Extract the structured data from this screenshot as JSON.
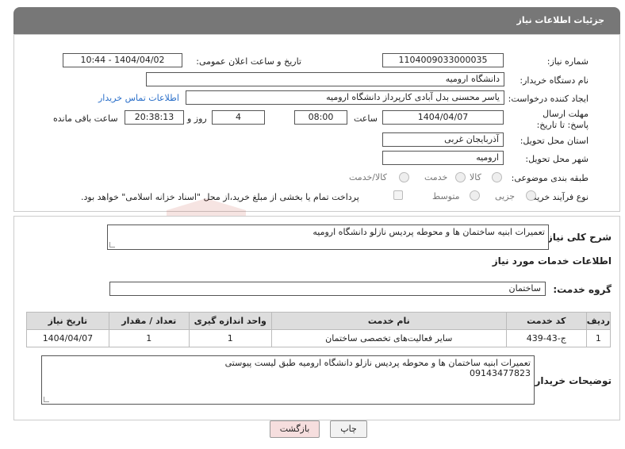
{
  "page_title": "جزئیات اطلاعات نیاز",
  "fields": {
    "need_number_label": "شماره نیاز:",
    "need_number": "1104009033000035",
    "announce_label": "تاریخ و ساعت اعلان عمومی:",
    "announce_value": "1404/04/02 - 10:44",
    "buyer_org_label": "نام دستگاه خریدار:",
    "buyer_org": "دانشگاه ارومیه",
    "creator_label": "ایجاد کننده درخواست:",
    "creator": "یاسر محسنی بدل آبادی کارپرداز دانشگاه ارومیه",
    "contact_link": "اطلاعات تماس خریدار",
    "deadline_label": "مهلت ارسال پاسخ: تا تاریخ:",
    "deadline_date": "1404/04/07",
    "time_label": "ساعت",
    "deadline_time": "08:00",
    "days_value": "4",
    "days_label": "روز و",
    "remaining_time": "20:38:13",
    "remaining_label": "ساعت باقی مانده",
    "province_label": "استان محل تحویل:",
    "province": "آذربایجان غربی",
    "city_label": "شهر محل تحویل:",
    "city": "ارومیه",
    "category_label": "طبقه بندی موضوعی:",
    "category_options": [
      "کالا",
      "خدمت",
      "کالا/خدمت"
    ],
    "process_label": "نوع فرآیند خرید :",
    "process_options": [
      "جزیی",
      "متوسط"
    ],
    "payment_note": "پرداخت تمام یا بخشی از مبلغ خرید،از محل \"اسناد خزانه اسلامی\" خواهد بود."
  },
  "summary": {
    "label": "شرح کلی نیاز:",
    "value": "تعمیرات ابنیه ساختمان ها و محوطه پردیس نازلو دانشگاه ارومیه"
  },
  "services_section": {
    "title": "اطلاعات خدمات مورد نیاز",
    "group_label": "گروه خدمت:",
    "group_value": "ساختمان",
    "columns": [
      "ردیف",
      "کد خدمت",
      "نام خدمت",
      "واحد اندازه گیری",
      "تعداد / مقدار",
      "تاریخ نیاز"
    ],
    "rows": [
      [
        "1",
        "ج-43-439",
        "سایر فعالیت‌های تخصصی ساختمان",
        "1",
        "1",
        "1404/04/07"
      ]
    ]
  },
  "buyer_notes": {
    "label": "توضیحات خریدار:",
    "line1": "تعمیرات ابنیه ساختمان ها و محوطه پردیس نازلو دانشگاه ارومیه طبق لیست پیوستی",
    "line2": "09143477823"
  },
  "buttons": {
    "print": "چاپ",
    "back": "بازگشت"
  },
  "watermark_text": "AriaTender.neT",
  "colors": {
    "header": "#777777",
    "link": "#2a6fc9",
    "back_button": "#f6dede",
    "watermark": "#c0392b"
  }
}
